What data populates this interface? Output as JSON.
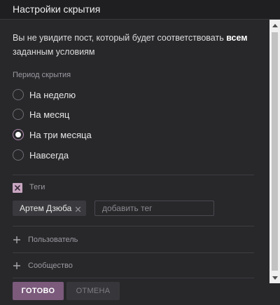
{
  "dialog": {
    "title": "Настройки скрытия",
    "intro_text": "Вы не увидите пост, который будет соответствовать ",
    "intro_bold": "всем",
    "intro_tail": " заданным условиям"
  },
  "period": {
    "label": "Период скрытия",
    "options": [
      {
        "label": "На неделю",
        "checked": false
      },
      {
        "label": "На месяц",
        "checked": false
      },
      {
        "label": "На три месяца",
        "checked": true
      },
      {
        "label": "Навсегда",
        "checked": false
      }
    ]
  },
  "tags": {
    "label": "Теги",
    "checked": true,
    "chips": [
      {
        "label": "Артем Дзюба"
      }
    ],
    "input_placeholder": "добавить тег"
  },
  "filters": {
    "user_label": "Пользователь",
    "community_label": "Сообщество"
  },
  "actions": {
    "confirm_label": "ГОТОВО",
    "cancel_label": "ОТМЕНА"
  },
  "colors": {
    "accent": "#7b5a7c",
    "checkbox": "#c8a5c0",
    "background": "#28282b"
  },
  "icons": {
    "chip_remove": "close-icon",
    "checkbox_mark": "cross-icon",
    "expand": "plus-icon",
    "scroll_up": "chevron-up-icon",
    "scroll_down": "chevron-down-icon"
  }
}
